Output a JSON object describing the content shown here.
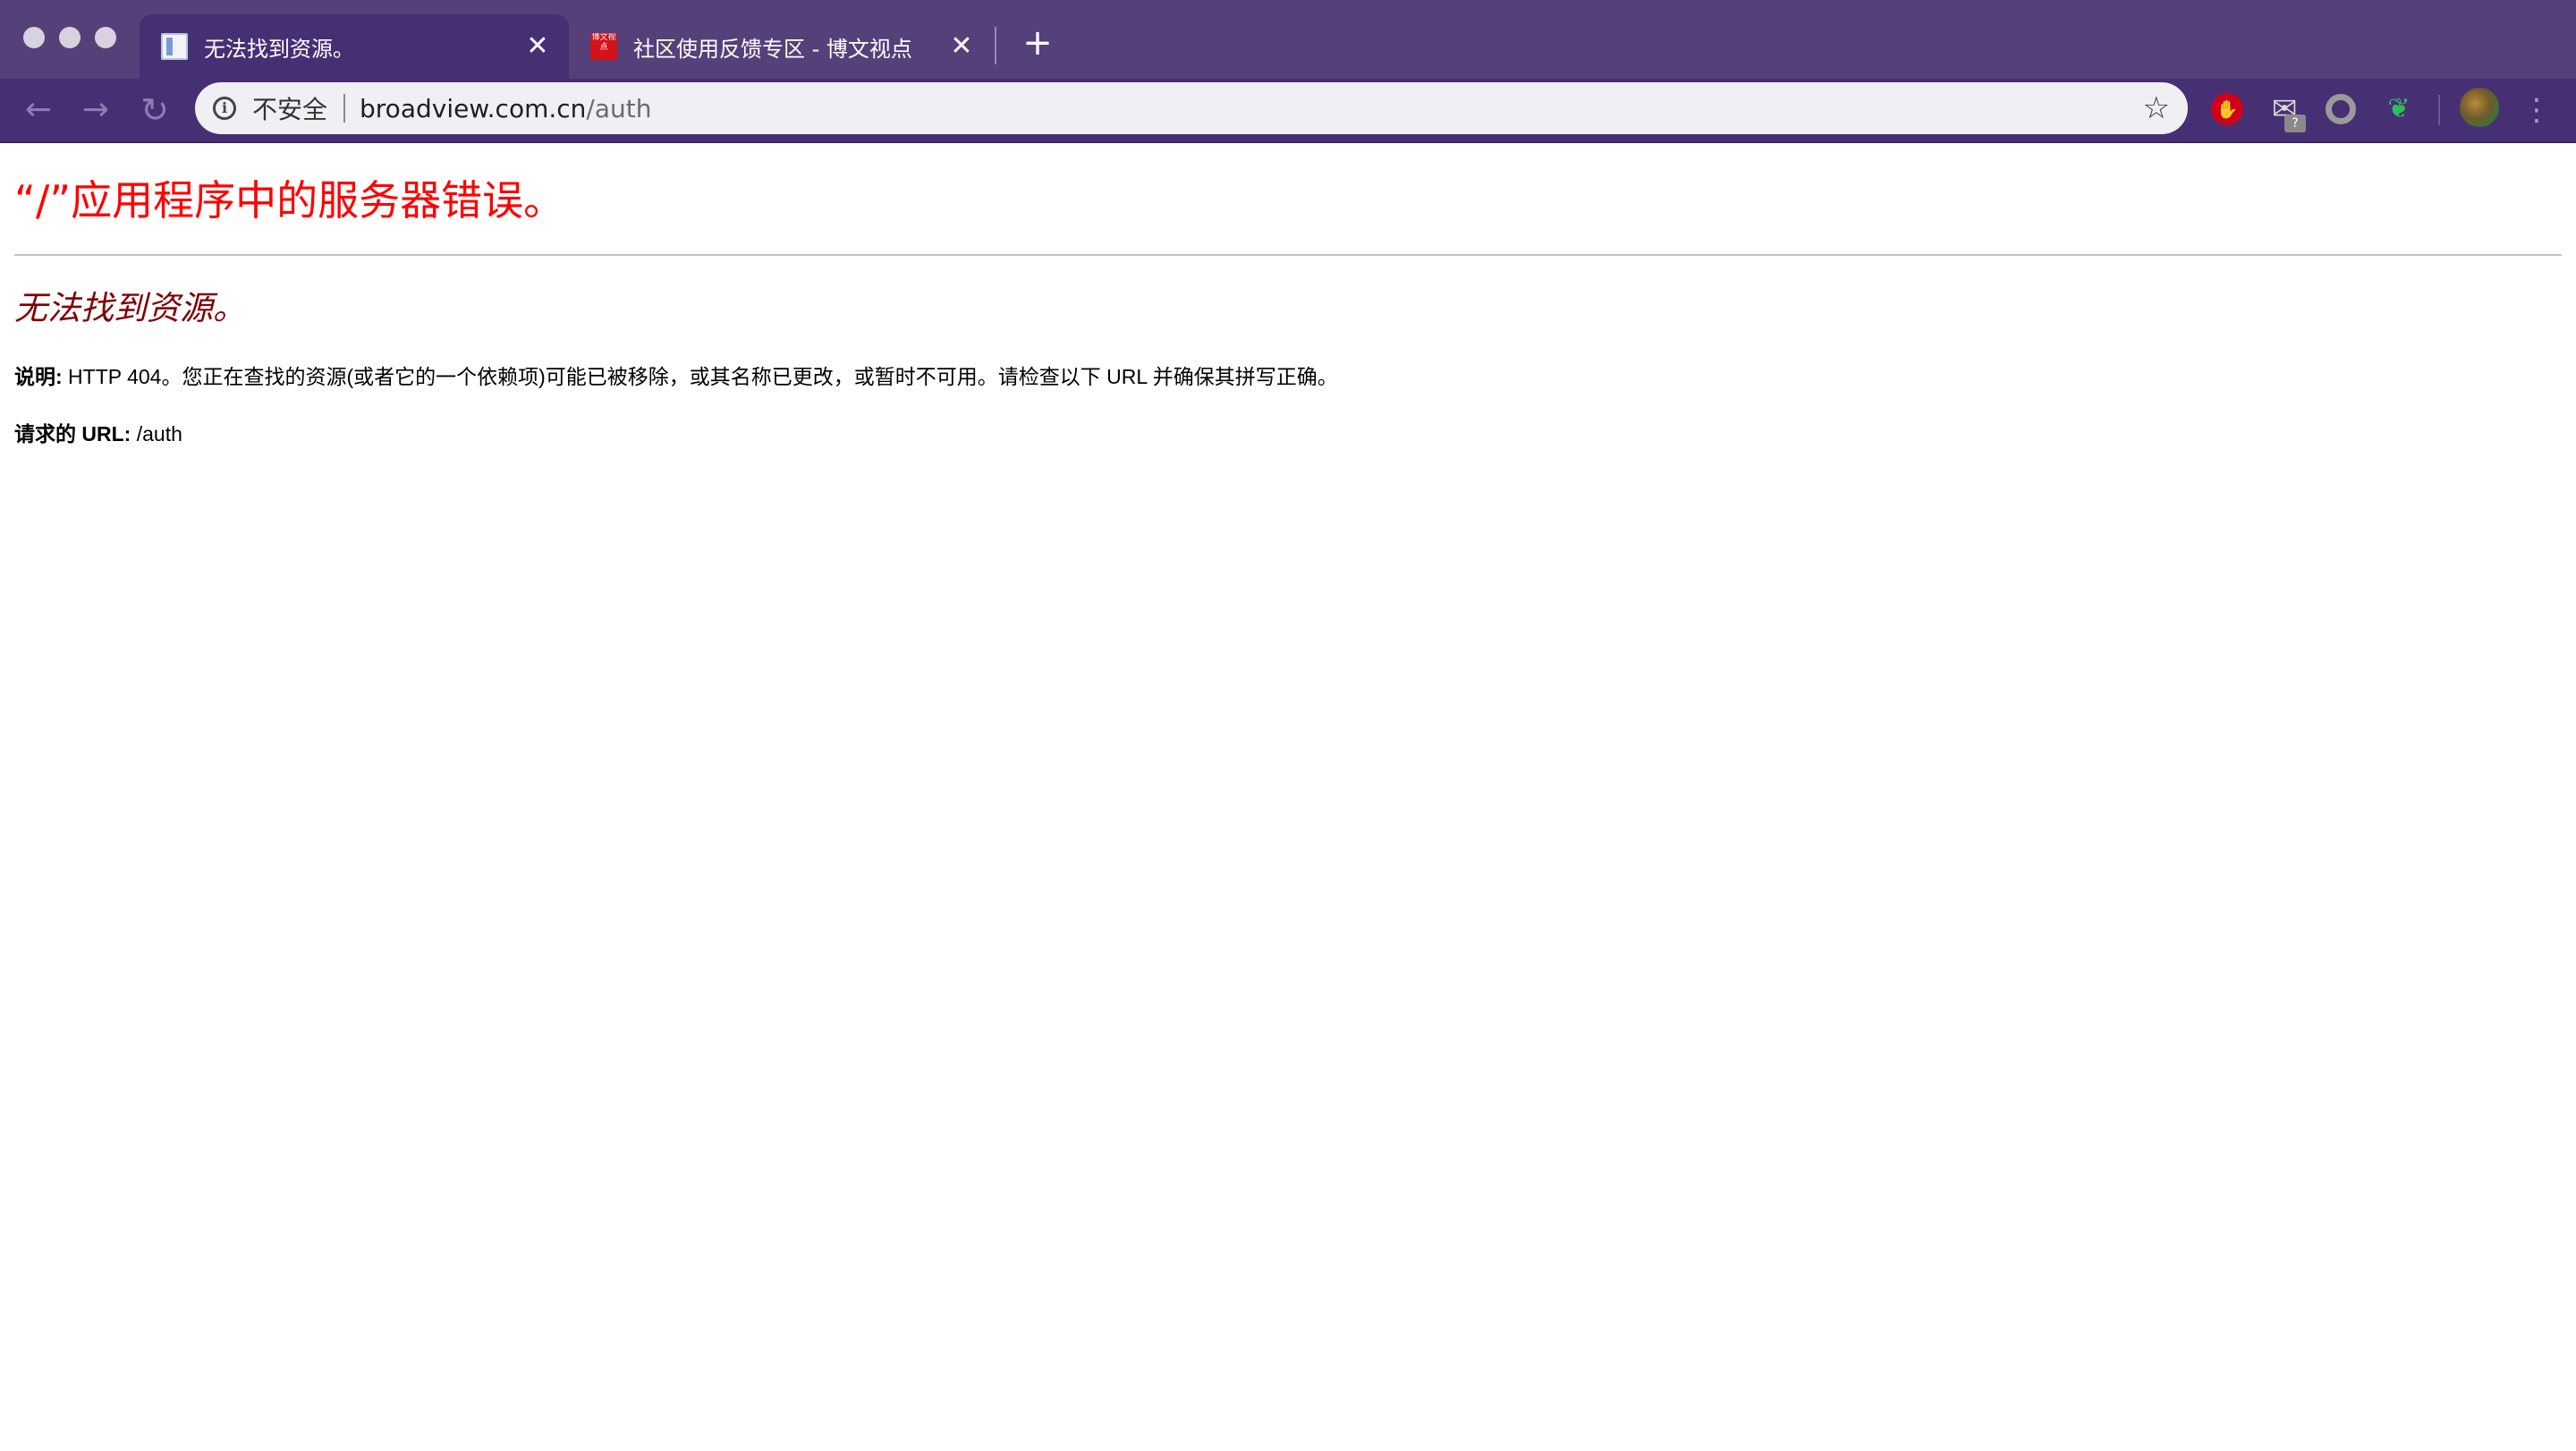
{
  "browser": {
    "tabs": [
      {
        "title": "无法找到资源。",
        "favicon": "document-icon",
        "active": true
      },
      {
        "title": "社区使用反馈专区 - 博文视点",
        "favicon": "broadview-icon",
        "favicon_text": "博文视点",
        "active": false
      }
    ],
    "close_glyph": "✕",
    "new_tab_glyph": "+",
    "address_bar": {
      "security_label": "不安全",
      "url_host": "broadview.com.cn",
      "url_path": "/auth"
    },
    "extensions": {
      "mail_badge": "?"
    },
    "colors": {
      "frame": "#55407a",
      "toolbar": "#472f74"
    }
  },
  "page": {
    "title": "“/”应用程序中的服务器错误。",
    "subtitle": "无法找到资源。",
    "description_label": "说明:",
    "description_text": " HTTP 404。您正在查找的资源(或者它的一个依赖项)可能已被移除，或其名称已更改，或暂时不可用。请检查以下 URL 并确保其拼写正确。",
    "request_label": "请求的 URL:",
    "request_value": " /auth",
    "colors": {
      "title": "#ff0000",
      "subtitle": "#800000"
    }
  }
}
